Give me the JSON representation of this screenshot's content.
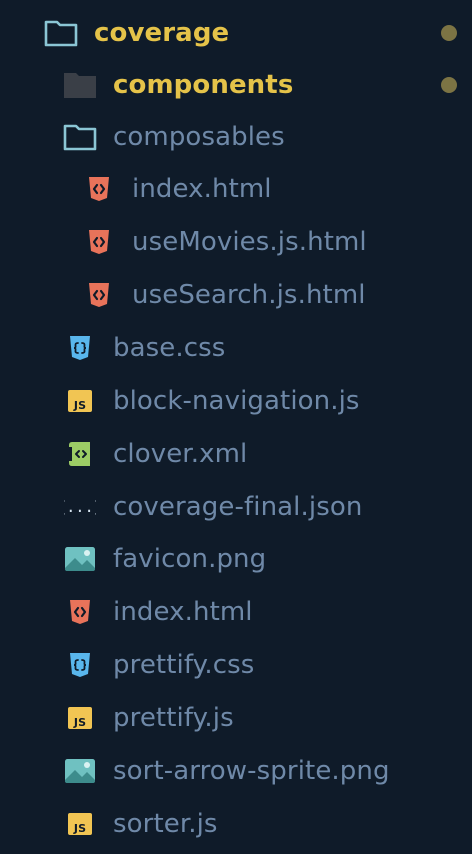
{
  "explorer": {
    "colors": {
      "background": "#0f1b29",
      "file_label": "#6f89a8",
      "modified_label": "#e5c349",
      "modified_dot": "#7c7444",
      "folder_outline": "#8bc6d5",
      "html_icon": "#e8735a",
      "css_icon": "#59b6ec",
      "js_icon": "#f1c553",
      "xml_icon": "#9ccc65",
      "json_icon": "#59b6ec",
      "image_icon": "#6fc1c1"
    },
    "items": [
      {
        "label": "coverage",
        "icon": "folder-open-icon",
        "modified": true
      },
      {
        "label": "components",
        "icon": "folder-closed-icon",
        "modified": true
      },
      {
        "label": "composables",
        "icon": "folder-open-icon",
        "modified": false
      },
      {
        "label": "index.html",
        "icon": "html-file-icon",
        "modified": false
      },
      {
        "label": "useMovies.js.html",
        "icon": "html-file-icon",
        "modified": false
      },
      {
        "label": "useSearch.js.html",
        "icon": "html-file-icon",
        "modified": false
      },
      {
        "label": "base.css",
        "icon": "css-file-icon",
        "modified": false
      },
      {
        "label": "block-navigation.js",
        "icon": "js-file-icon",
        "modified": false
      },
      {
        "label": "clover.xml",
        "icon": "xml-file-icon",
        "modified": false
      },
      {
        "label": "coverage-final.json",
        "icon": "json-file-icon",
        "modified": false
      },
      {
        "label": "favicon.png",
        "icon": "image-file-icon",
        "modified": false
      },
      {
        "label": "index.html",
        "icon": "html-file-icon",
        "modified": false
      },
      {
        "label": "prettify.css",
        "icon": "css-file-icon",
        "modified": false
      },
      {
        "label": "prettify.js",
        "icon": "js-file-icon",
        "modified": false
      },
      {
        "label": "sort-arrow-sprite.png",
        "icon": "image-file-icon",
        "modified": false
      },
      {
        "label": "sorter.js",
        "icon": "js-file-icon",
        "modified": false
      }
    ],
    "js_icon_text": "JS",
    "json_icon_text": "{...}"
  }
}
